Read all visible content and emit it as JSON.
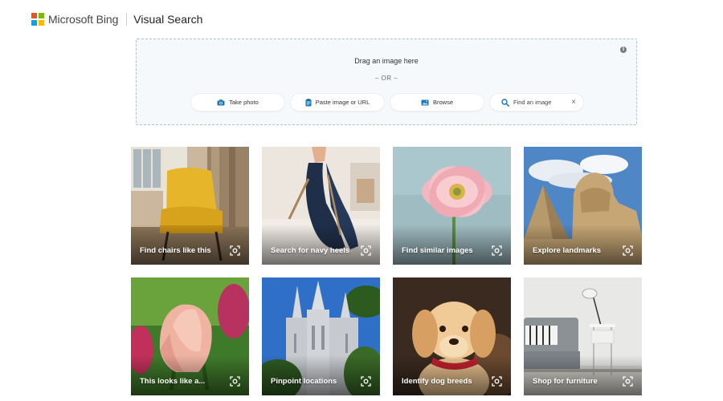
{
  "header": {
    "brand": "Microsoft Bing",
    "title": "Visual Search",
    "logo_colors": [
      "#f25022",
      "#7fba00",
      "#00a4ef",
      "#ffb900"
    ]
  },
  "dropzone": {
    "drag_text": "Drag an image here",
    "or_text": "– OR –",
    "info_icon": "info-icon",
    "actions": [
      {
        "label": "Take photo",
        "icon": "camera-icon"
      },
      {
        "label": "Paste image or URL",
        "icon": "paste-icon"
      },
      {
        "label": "Browse",
        "icon": "image-icon"
      }
    ],
    "search": {
      "placeholder": "Find an image",
      "icon": "search-icon"
    }
  },
  "tiles": [
    {
      "label": "Find chairs like this"
    },
    {
      "label": "Search for navy heels"
    },
    {
      "label": "Find similar images"
    },
    {
      "label": "Explore landmarks"
    },
    {
      "label": "This looks like a..."
    },
    {
      "label": "Pinpoint locations"
    },
    {
      "label": "Identify dog breeds"
    },
    {
      "label": "Shop for furniture"
    }
  ],
  "colors": {
    "accent": "#1a7ab5",
    "dropzone_border": "#a9c4cf"
  }
}
